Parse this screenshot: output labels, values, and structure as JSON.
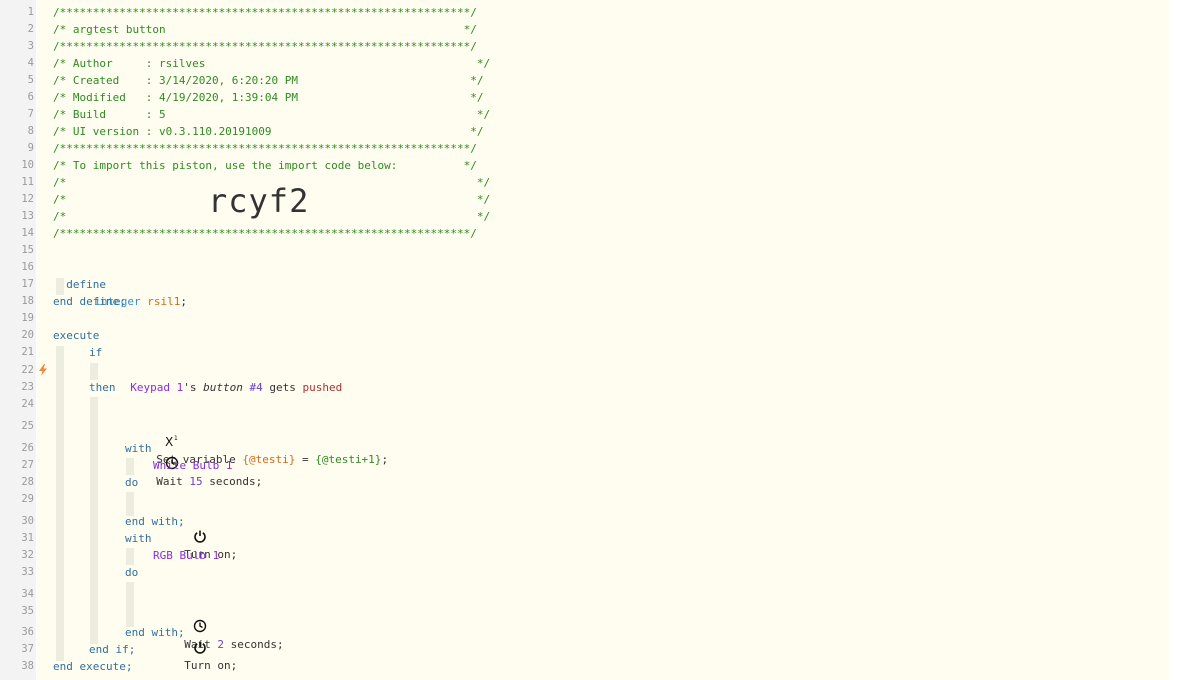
{
  "header": {
    "border": "/**************************************************************/",
    "title": "/* argtest button                                             */",
    "author": "/* Author     : rsilves                                         */",
    "created": "/* Created    : 3/14/2020, 6:20:20 PM                          */",
    "modified": "/* Modified   : 4/19/2020, 1:39:04 PM                          */",
    "build": "/* Build      : 5                                               */",
    "ui_version": "/* UI version : v0.3.110.20191009                              */",
    "import_note": "/* To import this piston, use the import code below:          */",
    "empty": "/*                                                              */",
    "import_code": "rcyf2"
  },
  "code": {
    "define": "define",
    "int_type": "integer",
    "var_name": "rsil1",
    "semicolon": ";",
    "end_define": "end define;",
    "execute": "execute",
    "if": "if",
    "device_keypad": "Keypad 1",
    "possessive": "'s ",
    "button_attr": "button",
    "button_num": " #4",
    "gets": " gets ",
    "pushed": "pushed",
    "then": "then",
    "set_variable": "Set variable ",
    "testi": "{@testi}",
    "equals": " = ",
    "expr": "{@testi+1}",
    "wait": "Wait ",
    "wait_15": "15",
    "seconds": " seconds;",
    "with": "with",
    "white_bulb": "White Bulb 1",
    "do": "do",
    "turn_on": "Turn on;",
    "end_with": "end with;",
    "rgb_bulb": "RGB Bulb 1",
    "wait_2": "2",
    "end_if": "end if;",
    "end_execute": "end execute;"
  },
  "line_numbers": [
    "1",
    "2",
    "3",
    "4",
    "5",
    "6",
    "7",
    "8",
    "9",
    "10",
    "11",
    "12",
    "13",
    "14",
    "15",
    "16",
    "17",
    "18",
    "19",
    "20",
    "21",
    "22",
    "23",
    "24",
    "25",
    "26",
    "27",
    "28",
    "29",
    "30",
    "31",
    "32",
    "33",
    "34",
    "35",
    "36",
    "37",
    "38"
  ],
  "icons": {
    "variable": "variable-x-icon",
    "clock": "clock-icon",
    "power": "power-icon",
    "trigger": "lightning-bolt-icon"
  },
  "colors": {
    "comment": "#2e8b22",
    "keyword": "#2f6f9f",
    "device": "#8a2be2",
    "variable": "#d2691e",
    "event": "#b03030",
    "background": "#fffdf0"
  }
}
